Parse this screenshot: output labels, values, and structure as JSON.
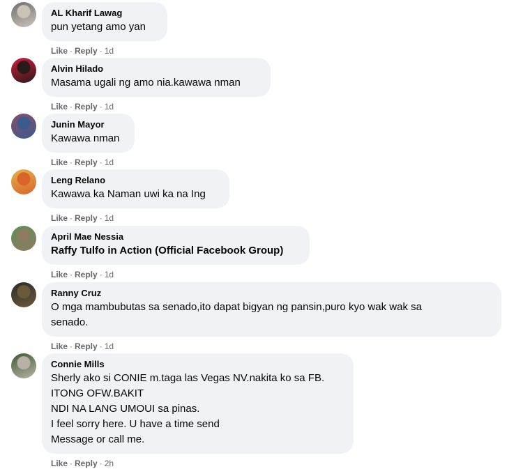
{
  "comments": [
    {
      "author": "AL Kharif Lawag",
      "lines": [
        "pun yetang amo yan"
      ],
      "like": "Like",
      "reply": "Reply",
      "sep": "·",
      "time": "1d",
      "avatar_colors": [
        "#6e6e6e",
        "#c9c3b8"
      ]
    },
    {
      "author": "Alvin Hilado",
      "lines": [
        "Masama ugali ng amo nia.kawawa nman"
      ],
      "like": "Like",
      "reply": "Reply",
      "sep": "·",
      "time": "1d",
      "avatar_colors": [
        "#d31c3c",
        "#2a1a1a"
      ]
    },
    {
      "author": "Junin Mayor",
      "lines": [
        "Kawawa nman"
      ],
      "like": "Like",
      "reply": "Reply",
      "sep": "·",
      "time": "1d",
      "avatar_colors": [
        "#8a4e6a",
        "#3c5a8c"
      ]
    },
    {
      "author": "Leng Relano",
      "lines": [
        "Kawawa ka Naman uwi ka na Ing"
      ],
      "like": "Like",
      "reply": "Reply",
      "sep": "·",
      "time": "1d",
      "avatar_colors": [
        "#e5b24a",
        "#d9652b"
      ]
    },
    {
      "author": "April Mae Nessia",
      "lines": [
        "Raffy Tulfo in Action (Official Facebook Group)"
      ],
      "is_link": true,
      "like": "Like",
      "reply": "Reply",
      "sep": "·",
      "time": "1d",
      "avatar_colors": [
        "#5f8f57",
        "#8d7a60"
      ]
    },
    {
      "author": "Ranny Cruz",
      "lines": [
        "O mga mambubutas sa senado,ito dapat bigyan ng pansin,puro kyo wak wak sa",
        "senado."
      ],
      "like": "Like",
      "reply": "Reply",
      "sep": "·",
      "time": "1d",
      "avatar_colors": [
        "#2b2b2b",
        "#6b5a3a"
      ]
    },
    {
      "author": "Connie Mills",
      "lines": [
        "Sherly ako si CONIE m.taga las Vegas NV.nakita ko sa FB.",
        "ITONG OFW.BAKIT",
        "NDI NA LANG UMOUI sa pinas.",
        "I feel sorry here. U have a time send",
        "Message or call me."
      ],
      "like": "Like",
      "reply": "Reply",
      "sep": "·",
      "time": "2h",
      "avatar_colors": [
        "#3f5a36",
        "#b7b2a4"
      ]
    }
  ]
}
